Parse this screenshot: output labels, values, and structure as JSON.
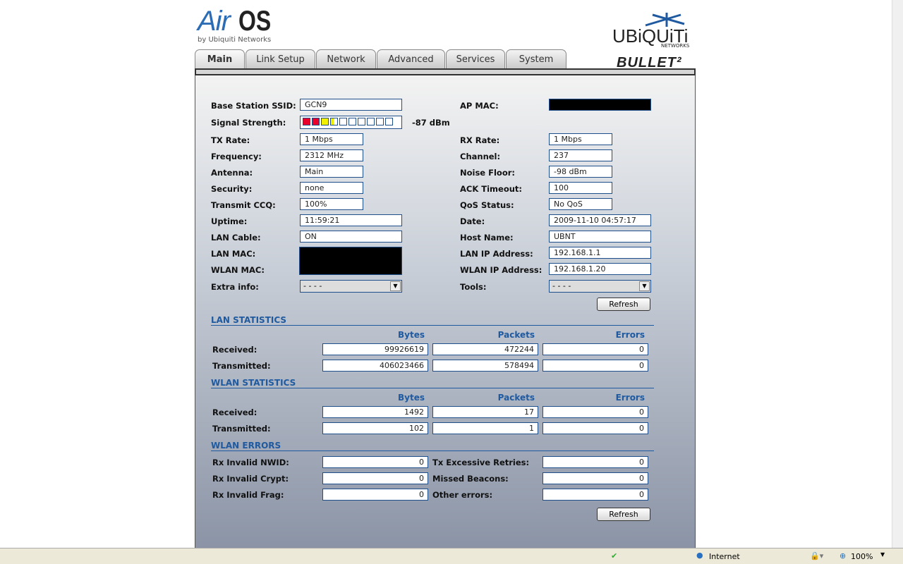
{
  "header": {
    "logo_air": "Air",
    "logo_os": "OS",
    "logo_by": "by Ubiquiti Networks",
    "brand": "UBiQUiTi",
    "brand_sub": "NETWORKS",
    "product": "BULLET²"
  },
  "tabs": [
    "Main",
    "Link Setup",
    "Network",
    "Advanced",
    "Services",
    "System"
  ],
  "left": [
    {
      "label": "Base Station SSID:",
      "value": "GCN9"
    },
    {
      "label": "Signal Strength:",
      "value": "-87 dBm",
      "bars_filled": 3.5,
      "bars_total": 10
    },
    {
      "label": "TX Rate:",
      "value": "1 Mbps"
    },
    {
      "label": "Frequency:",
      "value": "2312 MHz"
    },
    {
      "label": "Antenna:",
      "value": "Main"
    },
    {
      "label": "Security:",
      "value": "none"
    },
    {
      "label": "Transmit CCQ:",
      "value": "100%"
    },
    {
      "label": "Uptime:",
      "value": "11:59:21"
    },
    {
      "label": "LAN Cable:",
      "value": "ON"
    },
    {
      "label": "LAN MAC:"
    },
    {
      "label": "WLAN MAC:"
    },
    {
      "label": "Extra info:",
      "value": "- - - -"
    }
  ],
  "right": [
    {
      "label": "AP MAC:"
    },
    {
      "label": "RX Rate:",
      "value": "1 Mbps"
    },
    {
      "label": "Channel:",
      "value": "237"
    },
    {
      "label": "Noise Floor:",
      "value": "-98 dBm"
    },
    {
      "label": "ACK Timeout:",
      "value": "100"
    },
    {
      "label": "QoS Status:",
      "value": "No QoS"
    },
    {
      "label": "Date:",
      "value": "2009-11-10 04:57:17"
    },
    {
      "label": "Host Name:",
      "value": "UBNT"
    },
    {
      "label": "LAN IP Address:",
      "value": "192.168.1.1"
    },
    {
      "label": "WLAN IP Address:",
      "value": "192.168.1.20"
    },
    {
      "label": "Tools:",
      "value": "- - - -"
    }
  ],
  "refresh": "Refresh",
  "cols": [
    "Bytes",
    "Packets",
    "Errors"
  ],
  "lan": {
    "title": "LAN STATISTICS",
    "rows": [
      {
        "label": "Received:",
        "v": [
          "99926619",
          "472244",
          "0"
        ]
      },
      {
        "label": "Transmitted:",
        "v": [
          "406023466",
          "578494",
          "0"
        ]
      }
    ]
  },
  "wlan": {
    "title": "WLAN STATISTICS",
    "rows": [
      {
        "label": "Received:",
        "v": [
          "1492",
          "17",
          "0"
        ]
      },
      {
        "label": "Transmitted:",
        "v": [
          "102",
          "1",
          "0"
        ]
      }
    ]
  },
  "errors": {
    "title": "WLAN ERRORS",
    "rows": [
      {
        "l1": "Rx Invalid NWID:",
        "v1": "0",
        "l2": "Tx Excessive Retries:",
        "v2": "0"
      },
      {
        "l1": "Rx Invalid Crypt:",
        "v1": "0",
        "l2": "Missed Beacons:",
        "v2": "0"
      },
      {
        "l1": "Rx Invalid Frag:",
        "v1": "0",
        "l2": "Other errors:",
        "v2": "0"
      }
    ]
  },
  "statusbar": {
    "zone": "Internet",
    "zoom": "100%"
  }
}
